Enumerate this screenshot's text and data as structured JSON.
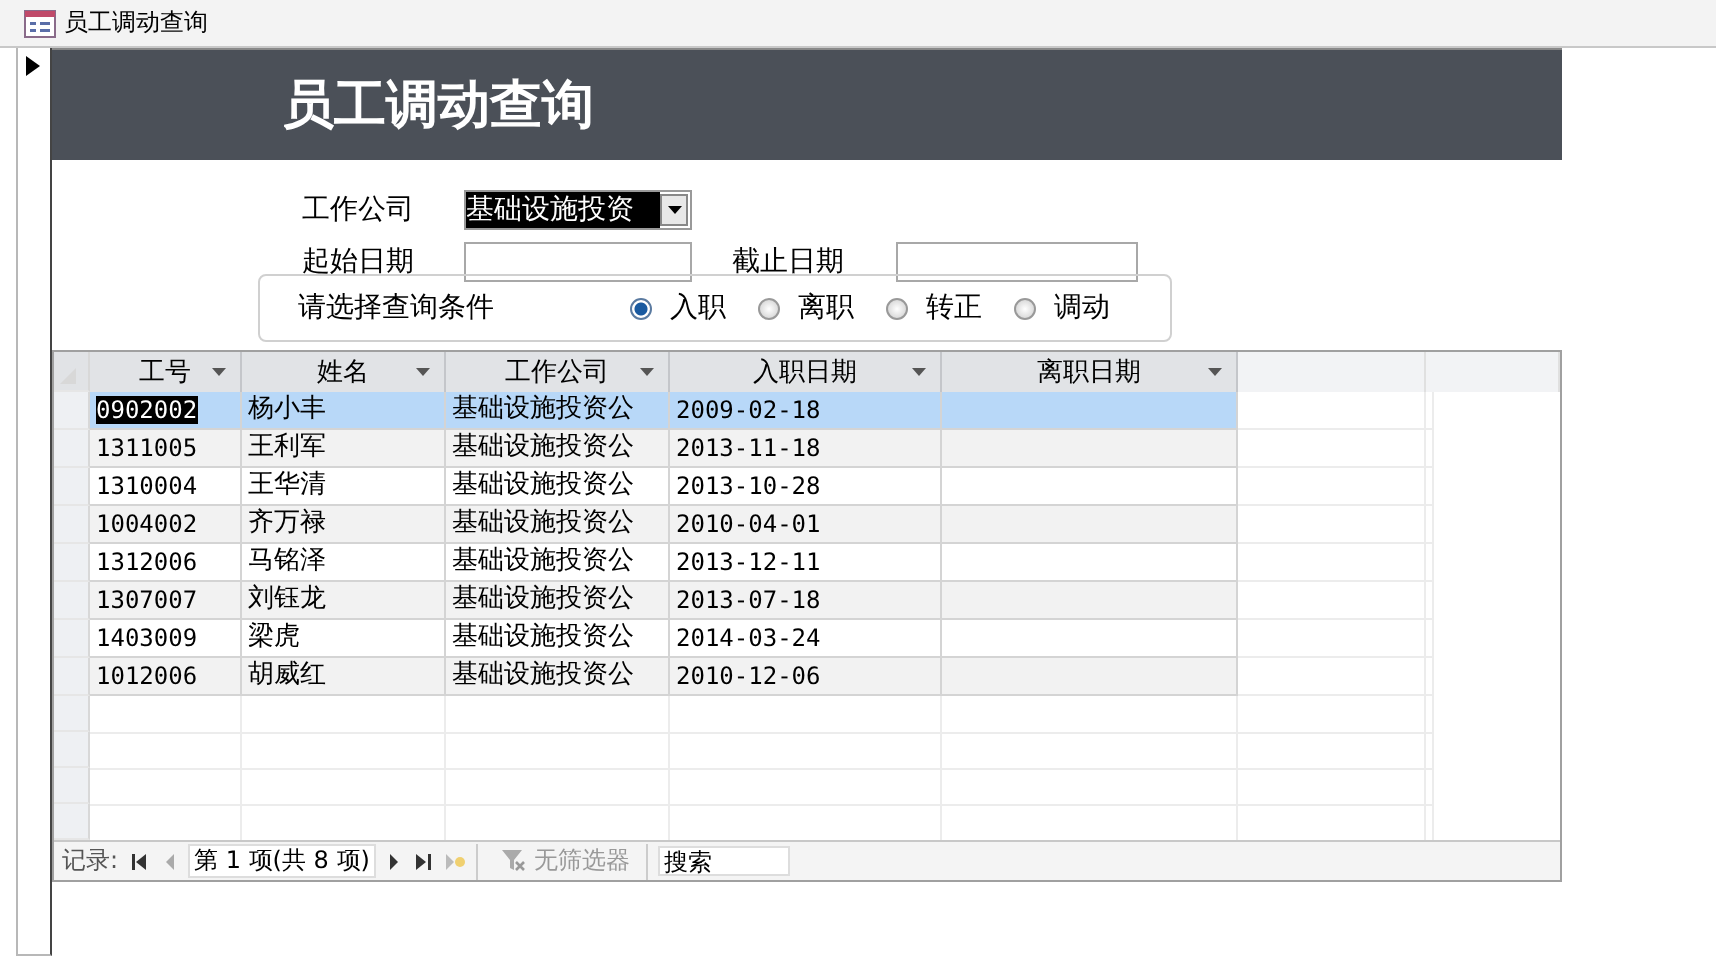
{
  "tab": {
    "title": "员工调动查询"
  },
  "form": {
    "title": "员工调动查询",
    "company": {
      "label": "工作公司",
      "value": "基础设施投资"
    },
    "start_date": {
      "label": "起始日期"
    },
    "end_date": {
      "label": "截止日期"
    },
    "condition": {
      "label": "请选择查询条件",
      "options": [
        {
          "label": "入职",
          "selected": true
        },
        {
          "label": "离职",
          "selected": false
        },
        {
          "label": "转正",
          "selected": false
        },
        {
          "label": "调动",
          "selected": false
        }
      ]
    }
  },
  "datasheet": {
    "columns": [
      "工号",
      "姓名",
      "工作公司",
      "入职日期",
      "离职日期"
    ],
    "rows": [
      {
        "cells": [
          "0902002",
          "杨小丰",
          "基础设施投资公",
          "2009-02-18"
        ],
        "selected": true
      },
      {
        "cells": [
          "1311005",
          "王利军",
          "基础设施投资公",
          "2013-11-18"
        ],
        "selected": false
      },
      {
        "cells": [
          "1310004",
          "王华清",
          "基础设施投资公",
          "2013-10-28"
        ],
        "selected": false
      },
      {
        "cells": [
          "1004002",
          "齐万禄",
          "基础设施投资公",
          "2010-04-01"
        ],
        "selected": false
      },
      {
        "cells": [
          "1312006",
          "马铭泽",
          "基础设施投资公",
          "2013-12-11"
        ],
        "selected": false
      },
      {
        "cells": [
          "1307007",
          "刘钰龙",
          "基础设施投资公",
          "2013-07-18"
        ],
        "selected": false
      },
      {
        "cells": [
          "1403009",
          "梁虎",
          "基础设施投资公",
          "2014-03-24"
        ],
        "selected": false
      },
      {
        "cells": [
          "1012006",
          "胡威红",
          "基础设施投资公",
          "2010-12-06"
        ],
        "selected": false
      }
    ],
    "navigator": {
      "label": "记录:",
      "position": "第 1 项(共 8 项)",
      "filter": "无筛选器",
      "search": {
        "placeholder": "搜索"
      }
    }
  }
}
